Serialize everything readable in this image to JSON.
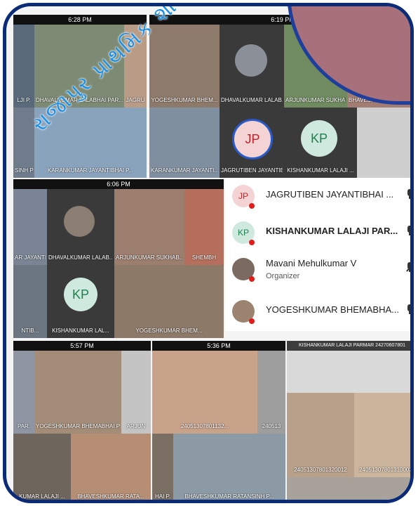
{
  "collage": {
    "watermark": "રાજાપુર પ્રાથમિક શાળા તા-ખાંટ"
  },
  "shot1": {
    "time": "6:28 PM",
    "tiles": [
      {
        "name": "DHAVALKUMAR LALABHAI PAR..."
      },
      {
        "name": "JAGRU"
      },
      {
        "name": "LJI P."
      },
      {
        "name": "SINH P."
      },
      {
        "name": "KARANKUMAR JAYANTIBHAI P..."
      }
    ]
  },
  "shot2": {
    "time": "6:19 PM",
    "status": "ᵢ₁ ⋯",
    "tiles": [
      {
        "name": "YOGESHKUMAR BHEM..."
      },
      {
        "name": "DHAVALKUMAR LALAB..."
      },
      {
        "name": "ARJUNKUMAR SUKHAB..."
      },
      {
        "name": "BHAVESHKUMAR RATA..."
      },
      {
        "name": "KARANKUMAR JAYANTI..."
      },
      {
        "name": "JAGRUTIBEN JAYANTIB..."
      },
      {
        "name": "KISHANKUMAR LALAJI ..."
      }
    ],
    "avatars": {
      "jp": "JP",
      "kp": "KP"
    }
  },
  "shot3": {
    "time": "6:06 PM",
    "tiles": [
      {
        "name": "AR JAYANTI..."
      },
      {
        "name": "DHAVALKUMAR LALAB..."
      },
      {
        "name": "ARJUNKUMAR SUKHAB..."
      },
      {
        "name": "SHEMBH"
      },
      {
        "name": "NTIB..."
      },
      {
        "name": "KISHANKUMAR LAL..."
      },
      {
        "name": "YOGESHKUMAR BHEM..."
      }
    ],
    "avatars": {
      "kp": "KP"
    }
  },
  "participants": [
    {
      "initials": "JP",
      "name": "JAGRUTIBEN JAYANTIBHAI ...",
      "role": "",
      "muted": false,
      "status_color": "#e21b1b"
    },
    {
      "initials": "KP",
      "name": "KISHANKUMAR LALAJI PAR...",
      "role": "",
      "muted": false,
      "status_color": "#e21b1b"
    },
    {
      "initials": "",
      "name": "Mavani Mehulkumar V",
      "role": "Organizer",
      "muted": true,
      "status_color": "#e21b1b"
    },
    {
      "initials": "",
      "name": "YOGESHKUMAR BHEMABHA...",
      "role": "",
      "muted": false,
      "status_color": "#e21b1b"
    }
  ],
  "shot4": {
    "time": "5:57 PM",
    "tiles": [
      {
        "name": "PAR."
      },
      {
        "name": "YOGESHKUMAR BHEMABHAI P..."
      },
      {
        "name": "ARJUN"
      },
      {
        "name": "KUMAR LALAJI ..."
      },
      {
        "name": "BHAVESHKUMAR RATA..."
      }
    ]
  },
  "shot5": {
    "time": "5:36 PM",
    "tiles": [
      {
        "name": "24051307801132..."
      },
      {
        "name": "240513"
      },
      {
        "name": "HAI P."
      },
      {
        "name": "BHAVESHKUMAR RATANSINH P..."
      }
    ]
  },
  "shot6": {
    "header": "KISHANKUMAR LALAJI PARMAR  24270607801",
    "tiles": [
      {
        "name": "24051307801320012"
      },
      {
        "name": "24051307801310002"
      }
    ]
  }
}
